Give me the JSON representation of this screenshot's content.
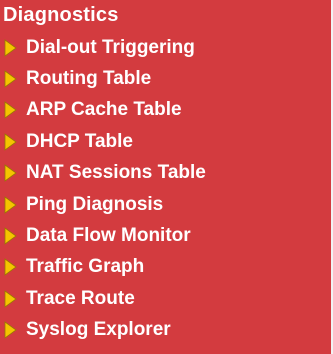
{
  "colors": {
    "panel_background": "#d33b3f",
    "text": "#ffffff",
    "bullet": "#f5c400"
  },
  "section": {
    "title": "Diagnostics"
  },
  "menu": {
    "items": [
      {
        "label": "Dial-out Triggering",
        "icon": "triangle-bullet-icon"
      },
      {
        "label": "Routing Table",
        "icon": "triangle-bullet-icon"
      },
      {
        "label": "ARP Cache Table",
        "icon": "triangle-bullet-icon"
      },
      {
        "label": "DHCP Table",
        "icon": "triangle-bullet-icon"
      },
      {
        "label": "NAT Sessions Table",
        "icon": "triangle-bullet-icon"
      },
      {
        "label": "Ping Diagnosis",
        "icon": "triangle-bullet-icon"
      },
      {
        "label": "Data Flow Monitor",
        "icon": "triangle-bullet-icon"
      },
      {
        "label": "Traffic Graph",
        "icon": "triangle-bullet-icon"
      },
      {
        "label": "Trace Route",
        "icon": "triangle-bullet-icon"
      },
      {
        "label": "Syslog Explorer",
        "icon": "triangle-bullet-icon"
      }
    ]
  }
}
